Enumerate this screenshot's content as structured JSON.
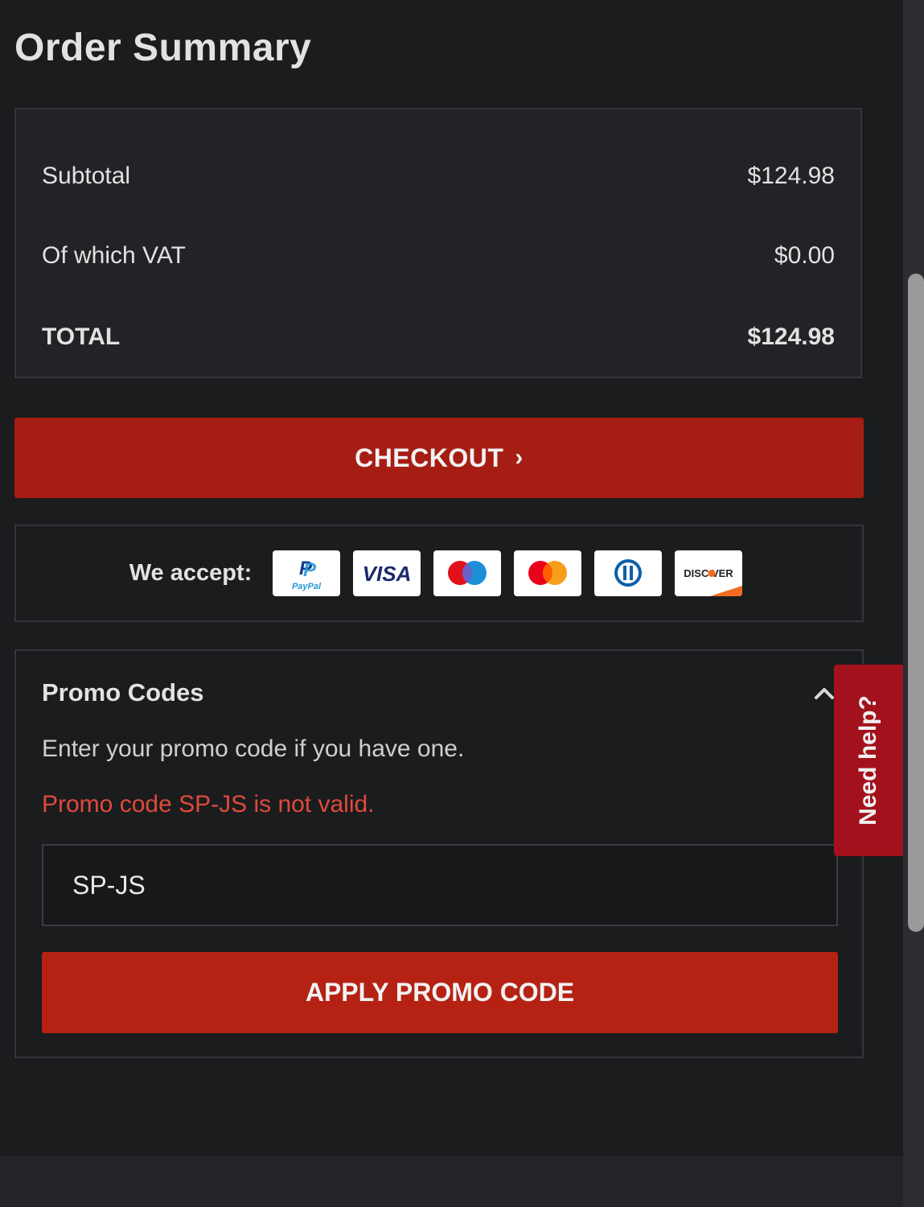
{
  "header": {
    "title": "Order Summary"
  },
  "summary": {
    "rows": [
      {
        "label": "Subtotal",
        "value": "$124.98"
      },
      {
        "label": "Of which VAT",
        "value": "$0.00"
      },
      {
        "label": "TOTAL",
        "value": "$124.98"
      }
    ]
  },
  "checkout": {
    "label": "CHECKOUT",
    "chevron": "›"
  },
  "payments": {
    "label": "We accept:",
    "methods": [
      "paypal-icon",
      "visa-icon",
      "maestro-icon",
      "mastercard-icon",
      "diners-club-icon",
      "discover-icon"
    ],
    "paypal_text": "PayPal",
    "visa_text": "VISA",
    "discover_text": "DISC VER"
  },
  "promo": {
    "title": "Promo Codes",
    "description": "Enter your promo code if you have one.",
    "error": "Promo code SP-JS is not valid.",
    "input_value": "SP-JS",
    "apply_label": "APPLY PROMO CODE"
  },
  "help": {
    "label": "Need help?"
  },
  "colors": {
    "accent": "#a61d13",
    "error": "#e04a3b",
    "help_tab": "#a3111c",
    "background": "#1b1c1e"
  }
}
